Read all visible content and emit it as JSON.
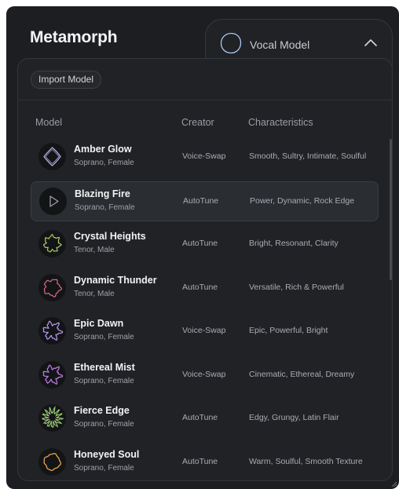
{
  "app": {
    "title": "Metamorph"
  },
  "tab": {
    "label": "Vocal Model"
  },
  "toolbar": {
    "import_label": "Import Model"
  },
  "table": {
    "columns": {
      "model": "Model",
      "creator": "Creator",
      "characteristics": "Characteristics"
    },
    "rows": [
      {
        "name": "Amber Glow",
        "voice": "Soprano, Female",
        "creator": "Voice-Swap",
        "characteristics": "Smooth, Sultry, Intimate, Soulful",
        "avatar": "diamond-wave-icon",
        "color": "#cfa8e8"
      },
      {
        "name": "Blazing Fire",
        "voice": "Soprano, Female",
        "creator": "AutoTune",
        "characteristics": "Power, Dynamic, Rock Edge",
        "avatar": "play-icon",
        "color": "#9a9da3"
      },
      {
        "name": "Crystal Heights",
        "voice": "Tenor, Male",
        "creator": "AutoTune",
        "characteristics": "Bright, Resonant, Clarity",
        "avatar": "jagged-circle-icon",
        "color": "#b8d470"
      },
      {
        "name": "Dynamic Thunder",
        "voice": "Tenor, Male",
        "creator": "AutoTune",
        "characteristics": "Versatile, Rich & Powerful",
        "avatar": "wobble-circle-icon",
        "color": "#e06a88"
      },
      {
        "name": "Epic Dawn",
        "voice": "Soprano, Female",
        "creator": "Voice-Swap",
        "characteristics": "Epic, Powerful, Bright",
        "avatar": "star-blob-icon",
        "color": "#b89af0"
      },
      {
        "name": "Ethereal Mist",
        "voice": "Soprano, Female",
        "creator": "Voice-Swap",
        "characteristics": "Cinematic, Ethereal, Dreamy",
        "avatar": "star-blob-icon",
        "color": "#c17ee8"
      },
      {
        "name": "Fierce Edge",
        "voice": "Soprano, Female",
        "creator": "AutoTune",
        "characteristics": "Edgy, Grungy, Latin Flair",
        "avatar": "spiky-burst-icon",
        "color": "#9fd27a"
      },
      {
        "name": "Honeyed Soul",
        "voice": "Soprano, Female",
        "creator": "AutoTune",
        "characteristics": "Warm, Soulful, Smooth Texture",
        "avatar": "soft-circle-icon",
        "color": "#e8a550"
      }
    ],
    "active_row": 1
  }
}
